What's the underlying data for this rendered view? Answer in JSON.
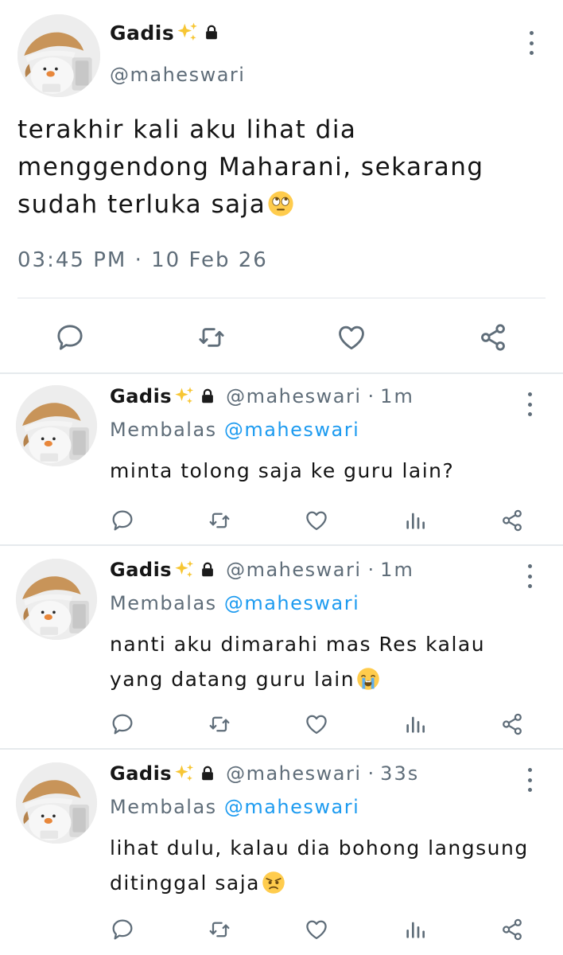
{
  "colors": {
    "accent": "#1d9bf0",
    "muted": "#5f6d79",
    "text": "#141414",
    "divider": "#e6eaed"
  },
  "main_tweet": {
    "name": "Gadis",
    "handle": "@maheswari",
    "name_icons": [
      "sparkles-icon",
      "lock-icon"
    ],
    "body": "terakhir kali aku lihat dia\nmenggendong Maharani, sekarang\nsudah terluka saja",
    "body_emoji": "face-with-rolling-eyes-icon",
    "timestamp": "03:45 PM · 10 Feb 26",
    "actions": [
      "reply-icon",
      "retweet-icon",
      "like-icon",
      "share-icon"
    ]
  },
  "replies": [
    {
      "name": "Gadis",
      "handle": "@maheswari",
      "separator": "·",
      "age": "1m",
      "replying_label": "Membalas",
      "replying_to": "@maheswari",
      "body": "minta tolong saja ke guru lain?",
      "body_emoji": "",
      "actions": [
        "reply-icon",
        "retweet-icon",
        "like-icon",
        "views-icon",
        "share-icon"
      ]
    },
    {
      "name": "Gadis",
      "handle": "@maheswari",
      "separator": "·",
      "age": "1m",
      "replying_label": "Membalas",
      "replying_to": "@maheswari",
      "body": "nanti aku dimarahi mas Res kalau\nyang datang guru lain",
      "body_emoji": "loudly-crying-face-icon",
      "actions": [
        "reply-icon",
        "retweet-icon",
        "like-icon",
        "views-icon",
        "share-icon"
      ]
    },
    {
      "name": "Gadis",
      "handle": "@maheswari",
      "separator": "·",
      "age": "33s",
      "replying_label": "Membalas",
      "replying_to": "@maheswari",
      "body": "lihat dulu, kalau dia bohong langsung\nditinggal saja",
      "body_emoji": "angry-face-icon",
      "actions": [
        "reply-icon",
        "retweet-icon",
        "like-icon",
        "views-icon",
        "share-icon"
      ]
    }
  ]
}
